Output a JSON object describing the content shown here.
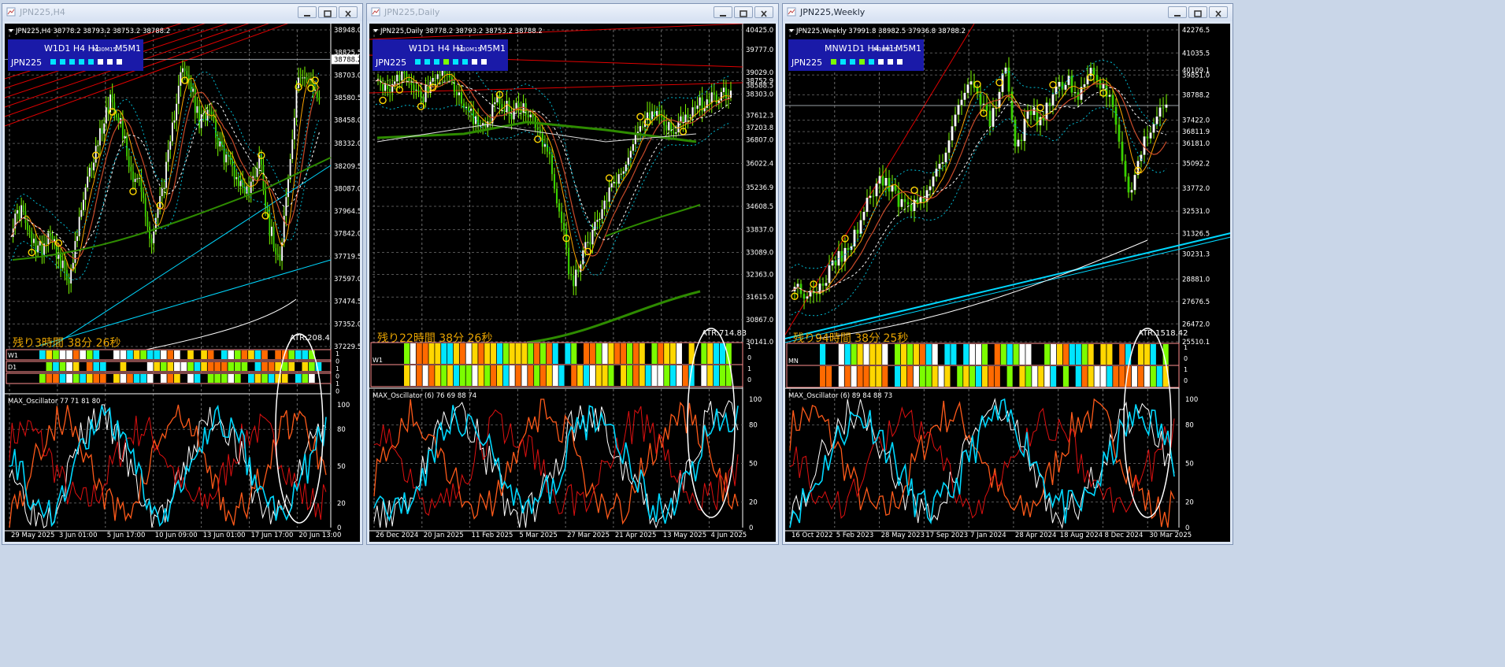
{
  "windows": [
    {
      "title": "JPN225,H4",
      "active": false
    },
    {
      "title": "JPN225,Daily",
      "active": false
    },
    {
      "title": "JPN225,Weekly",
      "active": true
    }
  ],
  "chart_data": [
    {
      "type": "candlestick",
      "symbol": "JPN225",
      "timeframe": "H4",
      "header": "JPN225,H4  38778.2 38793.2 38753.2 38788.2",
      "ohlc": {
        "open": 38778.2,
        "high": 38793.2,
        "low": 38753.2,
        "close": 38788.2
      },
      "price_ticks": [
        38948.0,
        38825.5,
        38703.0,
        38580.5,
        38458.0,
        38332.0,
        38209.5,
        38087.0,
        37964.5,
        37842.0,
        37719.5,
        37597.0,
        37474.5,
        37352.0,
        37229.5
      ],
      "current_price_label": "38788.2",
      "ylim": [
        37229.5,
        38948.0
      ],
      "x_ticks": [
        "29 May 2025",
        "3 Jun 01:00",
        "5 Jun 17:00",
        "10 Jun 09:00",
        "13 Jun 01:00",
        "17 Jun 17:00",
        "20 Jun 13:00"
      ],
      "panel": {
        "tf_labels": "W1D1 H4 H1",
        "tf_small": "M30M15",
        "tf_end": "M5M1",
        "symbol": "JPN225",
        "squares": [
          "#00e5ff",
          "#00e5ff",
          "#00e5ff",
          "#00e5ff",
          "#00e5ff",
          "#ffffff",
          "#ffffff",
          "#ffffff"
        ]
      },
      "countdown": "残り3時間 38分 26秒",
      "atr": "ATR:208.4",
      "strip_labels": [
        "W1",
        "D1",
        ""
      ],
      "strip_scale": [
        "1",
        "0",
        "1",
        "0",
        "1",
        "0"
      ],
      "oscillator": {
        "label": "MAX_Oscillator 77 71 81 80",
        "ticks": [
          "100",
          "80",
          "50",
          "20",
          "0"
        ],
        "values": [
          77,
          71,
          81,
          80
        ]
      }
    },
    {
      "type": "candlestick",
      "symbol": "JPN225",
      "timeframe": "Daily",
      "header": "JPN225,Daily  38778.2 38793.2 38753.2 38788.2",
      "ohlc": {
        "open": 38778.2,
        "high": 38793.2,
        "low": 38753.2,
        "close": 38788.2
      },
      "price_ticks": [
        40425.0,
        39777.0,
        39029.0,
        38752.9,
        38303.0,
        37612.3,
        37203.8,
        36807.0,
        36022.4,
        35236.9,
        34608.5,
        33837.0,
        33089.0,
        32363.0,
        31615.0,
        30867.0,
        30141.0
      ],
      "extra_labels": [
        "38588.5"
      ],
      "ylim": [
        30141.0,
        40425.0
      ],
      "x_ticks": [
        "26 Dec 2024",
        "20 Jan 2025",
        "11 Feb 2025",
        "5 Mar 2025",
        "27 Mar 2025",
        "21 Apr 2025",
        "13 May 2025",
        "4 Jun 2025"
      ],
      "panel": {
        "tf_labels": "W1D1 H4 H1",
        "tf_small": "M30M15",
        "tf_end": "M5M1",
        "symbol": "JPN225",
        "squares": [
          "#00e5ff",
          "#00e5ff",
          "#00e5ff",
          "#7cfc00",
          "#00e5ff",
          "#00e5ff",
          "#ffffff",
          "#ffffff"
        ]
      },
      "countdown": "残り22時間 38分 26秒",
      "atr": "ATR:714.83",
      "strip_labels": [
        "W1",
        ""
      ],
      "strip_scale": [
        "1",
        "0",
        "1",
        "0"
      ],
      "oscillator": {
        "label": "MAX_Oscillator (6) 76 69 88 74",
        "ticks": [
          "100",
          "80",
          "50",
          "20",
          "0"
        ],
        "values": [
          76,
          69,
          88,
          74
        ]
      }
    },
    {
      "type": "candlestick",
      "symbol": "JPN225",
      "timeframe": "Weekly",
      "header": "JPN225,Weekly  37991.8 38982.5 37936.8 38788.2",
      "ohlc": {
        "open": 37991.8,
        "high": 38982.5,
        "low": 37936.8,
        "close": 38788.2
      },
      "price_ticks": [
        42276.5,
        41035.5,
        40109.1,
        39851.0,
        38788.2,
        37422.0,
        36811.9,
        36181.0,
        35092.2,
        33772.0,
        32531.0,
        31326.5,
        30231.3,
        28881.0,
        27676.5,
        26472.0,
        25510.1
      ],
      "ylim": [
        25510.1,
        42276.5
      ],
      "x_ticks": [
        "16 Oct 2022",
        "5 Feb 2023",
        "28 May 2023",
        "17 Sep 2023",
        "7 Jan 2024",
        "28 Apr 2024",
        "18 Aug 2024",
        "8 Dec 2024",
        "30 Mar 2025"
      ],
      "panel": {
        "tf_labels": "MNW1D1 H4 H1",
        "tf_small": "M30M15",
        "tf_end": "M5M1",
        "symbol": "JPN225",
        "squares": [
          "#7cfc00",
          "#00e5ff",
          "#00e5ff",
          "#7cfc00",
          "#00e5ff",
          "#ffffff",
          "#ffffff",
          "#ffffff"
        ]
      },
      "countdown": "残り94時間 38分 25秒",
      "atr": "ATR:1518.42",
      "strip_labels": [
        "MN",
        ""
      ],
      "strip_scale": [
        "1",
        "0",
        "1",
        "0"
      ],
      "oscillator": {
        "label": "MAX_Oscillator (6) 89 84 88 73",
        "ticks": [
          "100",
          "80",
          "50",
          "20",
          "0"
        ],
        "values": [
          89,
          84,
          88,
          73
        ]
      }
    }
  ]
}
